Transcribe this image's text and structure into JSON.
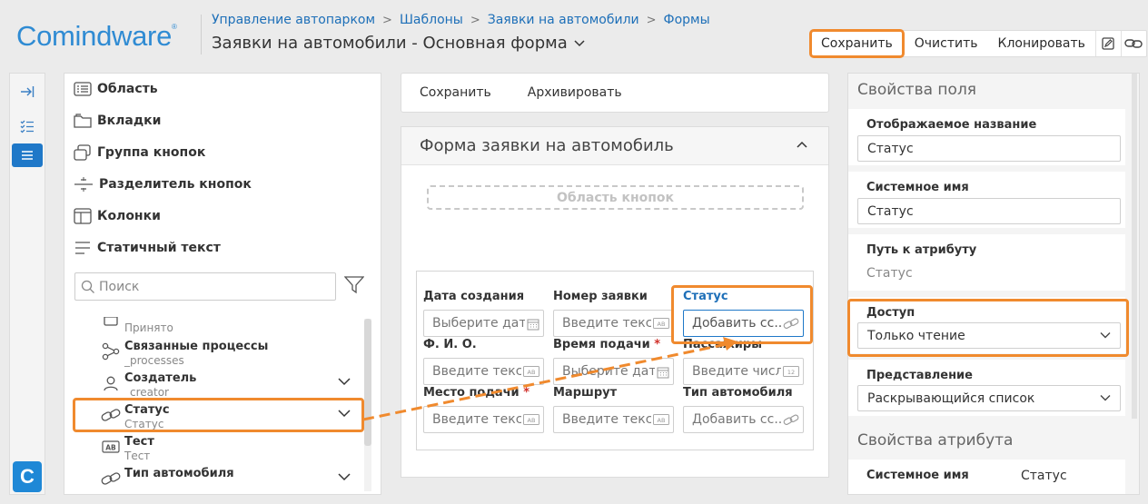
{
  "brand": {
    "name": "Comindware",
    "mark": "®"
  },
  "breadcrumb": [
    "Управление автопарком",
    "Шаблоны",
    "Заявки на автомобили",
    "Формы"
  ],
  "page_title": "Заявки на автомобили - Основная форма",
  "toolbar": {
    "save": "Сохранить",
    "clear": "Очистить",
    "clone": "Клонировать",
    "icons": [
      "edit-icon",
      "link-icon"
    ]
  },
  "elements": {
    "items": [
      "Область",
      "Вкладки",
      "Группа кнопок",
      "Разделитель кнопок",
      "Колонки",
      "Статичный текст"
    ],
    "search_placeholder": "Поиск",
    "attributes": [
      {
        "name": "",
        "sub": "Принято",
        "icon": "calendar-icon"
      },
      {
        "name": "Связанные процессы",
        "sub": "_processes",
        "icon": "process-icon"
      },
      {
        "name": "Создатель",
        "sub": "_creator",
        "icon": "user-icon"
      },
      {
        "name": "Статус",
        "sub": "Статус",
        "icon": "link-icon"
      },
      {
        "name": "Тест",
        "sub": "Тест",
        "icon": "text-icon"
      },
      {
        "name": "Тип автомобиля",
        "sub": "",
        "icon": "link-icon"
      }
    ]
  },
  "center_toolbar": {
    "save": "Сохранить",
    "archive": "Архивировать"
  },
  "form": {
    "title": "Форма заявки на автомобиль",
    "button_area": "Область кнопок",
    "fields": [
      {
        "label": "Дата создания",
        "req": "",
        "placeholder": "Выберите дату",
        "icon": "calendar-icon"
      },
      {
        "label": "Номер заявки",
        "req": "",
        "placeholder": "Введите текст",
        "icon": "text-icon"
      },
      {
        "label": "Статус",
        "req": "",
        "placeholder": "Добавить сс...",
        "icon": "link-icon"
      },
      {
        "label": "Ф. И. О.",
        "req": "",
        "placeholder": "Введите текст",
        "icon": "text-icon"
      },
      {
        "label": "Время подачи",
        "req": "*",
        "placeholder": "Выберите дату",
        "icon": "calendar-icon"
      },
      {
        "label": "Пассажиры",
        "req": "",
        "placeholder": "Введите число",
        "icon": "number-icon"
      },
      {
        "label": "Место подачи",
        "req": "*",
        "placeholder": "Введите текст",
        "icon": "text-icon"
      },
      {
        "label": "Маршрут",
        "req": "",
        "placeholder": "Введите текст",
        "icon": "text-icon"
      },
      {
        "label": "Тип автомобиля",
        "req": "",
        "placeholder": "Добавить сс...",
        "icon": "link-icon"
      }
    ]
  },
  "properties": {
    "field_header": "Свойства поля",
    "display_name_label": "Отображаемое название",
    "display_name_value": "Статус",
    "system_name_label": "Системное имя",
    "system_name_value": "Статус",
    "attr_path_label": "Путь к атрибуту",
    "attr_path_value": "Статус",
    "access_label": "Доступ",
    "access_value": "Только чтение",
    "view_label": "Представление",
    "view_value": "Раскрывающийся список",
    "attr_header": "Свойства атрибута",
    "attr_system_name_label": "Системное имя",
    "attr_system_name_value": "Статус"
  },
  "colors": {
    "accent": "#1f78c8",
    "highlight": "#f08a2e",
    "link": "#1d6fb8"
  }
}
